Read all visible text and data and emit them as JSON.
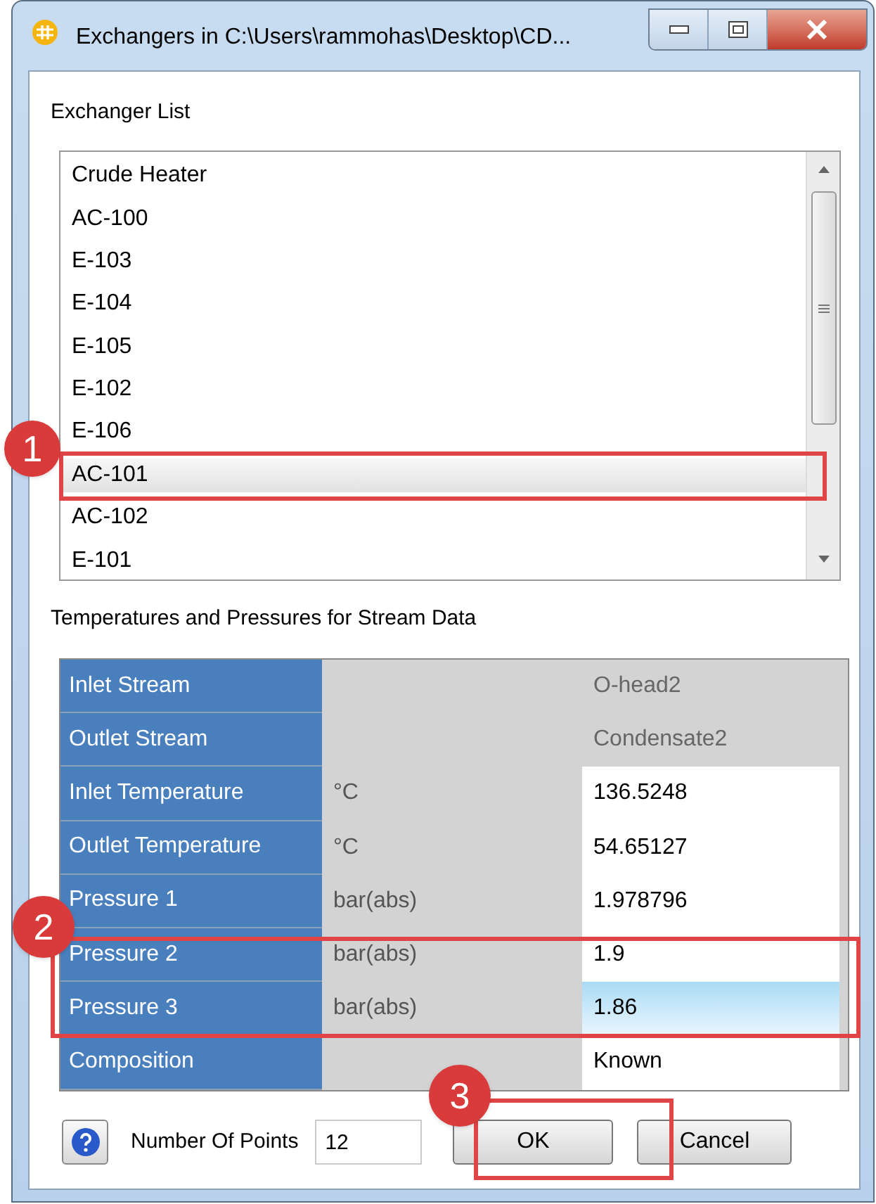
{
  "window": {
    "title": "Exchangers in C:\\Users\\rammohas\\Desktop\\CD..."
  },
  "exchanger_list": {
    "label": "Exchanger List",
    "items": [
      {
        "label": "Crude Heater",
        "selected": false
      },
      {
        "label": "AC-100",
        "selected": false
      },
      {
        "label": "E-103",
        "selected": false
      },
      {
        "label": "E-104",
        "selected": false
      },
      {
        "label": "E-105",
        "selected": false
      },
      {
        "label": "E-102",
        "selected": false
      },
      {
        "label": "E-106",
        "selected": false
      },
      {
        "label": "AC-101",
        "selected": true
      },
      {
        "label": "AC-102",
        "selected": false
      },
      {
        "label": "E-101",
        "selected": false
      }
    ]
  },
  "stream_data": {
    "label": "Temperatures and Pressures for Stream Data",
    "rows": [
      {
        "name": "Inlet Stream",
        "unit": "",
        "value": "O-head2",
        "readonly": true,
        "selected": false
      },
      {
        "name": "Outlet Stream",
        "unit": "",
        "value": "Condensate2",
        "readonly": true,
        "selected": false
      },
      {
        "name": "Inlet Temperature",
        "unit": "°C",
        "value": "136.5248",
        "readonly": false,
        "selected": false
      },
      {
        "name": "Outlet Temperature",
        "unit": "°C",
        "value": "54.65127",
        "readonly": false,
        "selected": false
      },
      {
        "name": "Pressure 1",
        "unit": "bar(abs)",
        "value": "1.978796",
        "readonly": false,
        "selected": false
      },
      {
        "name": "Pressure 2",
        "unit": "bar(abs)",
        "value": "1.9",
        "readonly": false,
        "selected": false
      },
      {
        "name": "Pressure 3",
        "unit": "bar(abs)",
        "value": "1.86",
        "readonly": false,
        "selected": true
      },
      {
        "name": "Composition",
        "unit": "",
        "value": "Known",
        "readonly": false,
        "selected": false
      }
    ]
  },
  "footer": {
    "points_label": "Number Of Points",
    "points_value": "12",
    "buttons": [
      "OK",
      "Cancel"
    ]
  },
  "callouts": [
    {
      "number": "1"
    },
    {
      "number": "2"
    },
    {
      "number": "3"
    }
  ]
}
